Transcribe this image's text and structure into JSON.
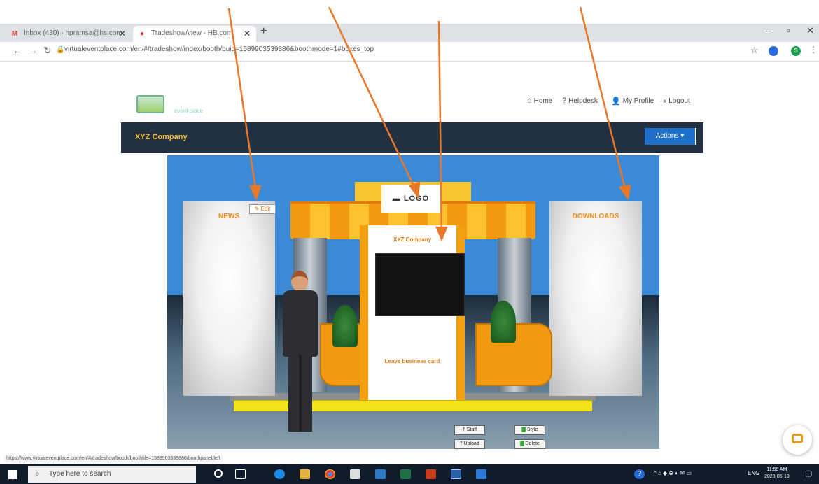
{
  "browser": {
    "tabs": [
      {
        "label": "Inbox (430) - hpramsa@hs.com",
        "favicon": "M"
      },
      {
        "label": "Tradeshow/view - HB.com",
        "favicon": "●"
      }
    ],
    "url": "virtualeventplace.com/en/#/tradeshow/index/booth/buid=1589903539886&boothmode=1#boxes_top",
    "new_tab": "+",
    "profile_initial": "S"
  },
  "site": {
    "brand_text": "event place",
    "nav": {
      "home": "Home",
      "helpdesk": "Helpdesk",
      "profile": "My Profile",
      "logout": "Logout"
    },
    "company": "XYZ Company",
    "actions_label": "Actions ▾"
  },
  "booth": {
    "left_wall_title": "NEWS",
    "right_wall_title": "DOWNLOADS",
    "edit_label": "Edit",
    "logo_text": "LOGO",
    "center_title": "XYZ Company",
    "leave_card": "Leave business card",
    "tools": {
      "staff": "Staff",
      "style": "Style",
      "upload": "Upload",
      "delete": "Delete"
    }
  },
  "status_bar_url": "https://www.virtualeventplace.com/en/#/tradeshow/booth/boothfile=1589903539886/boothpanel/left",
  "taskbar": {
    "search_placeholder": "Type here to search",
    "language": "ENG",
    "time": "11:59 AM",
    "date": "2020-05-19"
  },
  "colors": {
    "accent_orange": "#f39a10",
    "company_bar": "#233041",
    "actions_blue": "#1e6fc8",
    "arrow": "#e8772a"
  }
}
